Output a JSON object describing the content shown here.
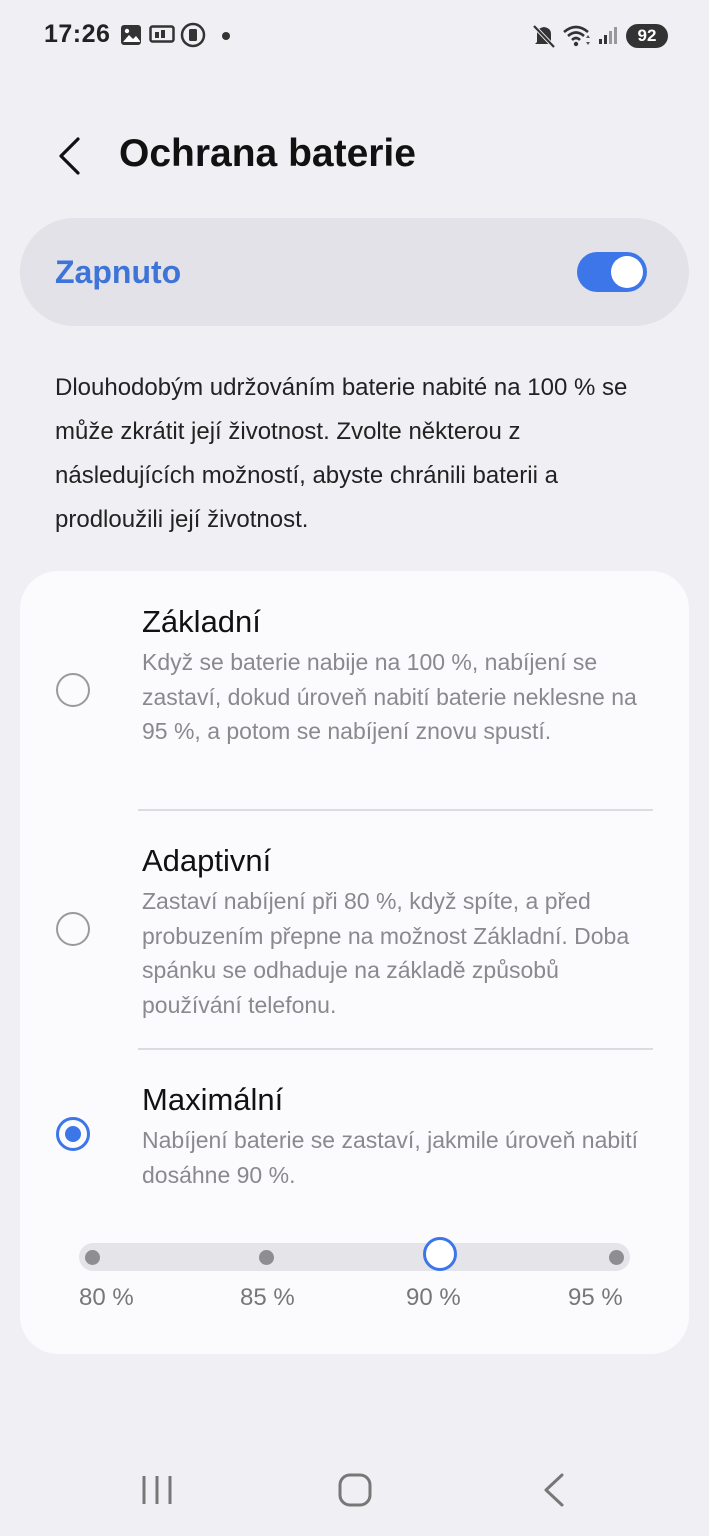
{
  "status_bar": {
    "time": "17:26",
    "icons": [
      "gallery-icon",
      "cast-icon",
      "vibrate-icon",
      "dot-icon"
    ],
    "right_icons": [
      "mute-icon",
      "wifi-icon",
      "signal-icon"
    ],
    "battery": "92"
  },
  "header": {
    "back_icon": "chevron-left-icon",
    "title": "Ochrana baterie"
  },
  "master_switch": {
    "label": "Zapnuto",
    "on": true,
    "accent": "#3c76e8"
  },
  "description": "Dlouhodobým udržováním baterie nabité na 100 % se může zkrátit její životnost. Zvolte některou z následujících možností, abyste chránili baterii a prodloužili její životnost.",
  "options": [
    {
      "title": "Základní",
      "description": "Když se baterie nabije na 100 %, nabíjení se zastaví, dokud úroveň nabití baterie neklesne na 95 %, a potom se nabíjení znovu spustí.",
      "selected": false
    },
    {
      "title": "Adaptivní",
      "description": "Zastaví nabíjení při 80 %, když spíte, a před probuzením přepne na možnost Základní. Doba spánku se odhaduje na základě způsobů používání telefonu.",
      "selected": false
    },
    {
      "title": "Maximální",
      "description": "Nabíjení baterie se zastaví, jakmile úroveň nabití dosáhne 90 %.",
      "selected": true
    }
  ],
  "slider": {
    "stops": [
      "80 %",
      "85 %",
      "90 %",
      "95 %"
    ],
    "selected_value": "90 %",
    "selected_index": 2
  },
  "nav_bar": {
    "icons": [
      "recent-apps-icon",
      "home-icon",
      "back-icon"
    ]
  }
}
